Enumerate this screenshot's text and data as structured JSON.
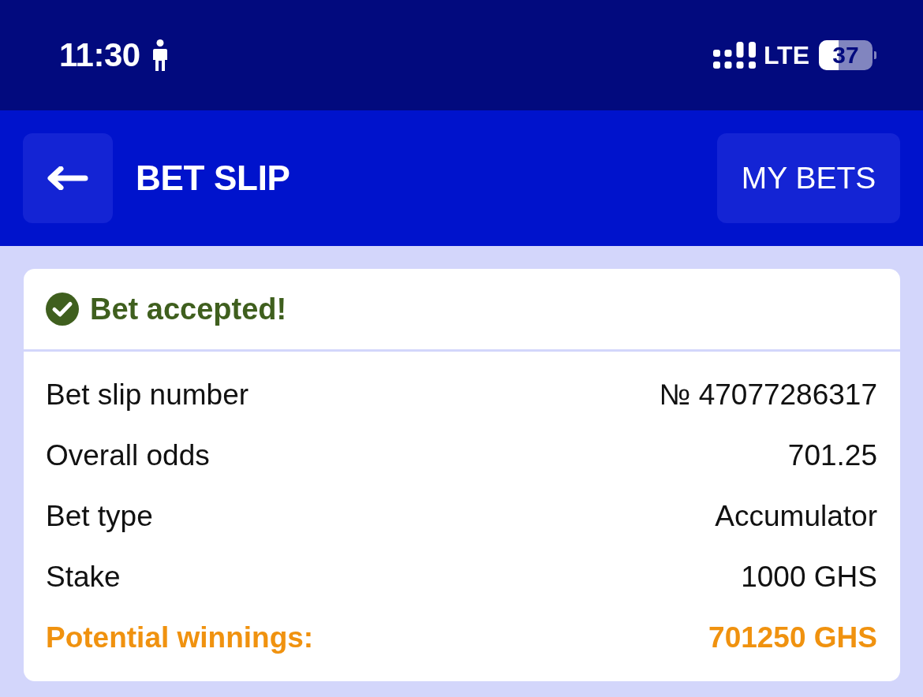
{
  "status_bar": {
    "time": "11:30",
    "network": "LTE",
    "battery": {
      "level": 0.37,
      "reading": "37"
    }
  },
  "header": {
    "title": "BET SLIP",
    "action": "MY BETS"
  },
  "card": {
    "status": {
      "kind": "success",
      "message": "Bet accepted!"
    },
    "rows": [
      {
        "kind": "plain",
        "label": "Bet slip number",
        "value": "№ 47077286317"
      },
      {
        "kind": "plain",
        "label": "Overall odds",
        "value": "701.25"
      },
      {
        "kind": "plain",
        "label": "Bet type",
        "value": "Accumulator"
      },
      {
        "kind": "plain",
        "label": "Stake",
        "value": "1000 GHS"
      },
      {
        "kind": "highlight",
        "label": "Potential winnings:",
        "value": "701250 GHS"
      }
    ]
  }
}
